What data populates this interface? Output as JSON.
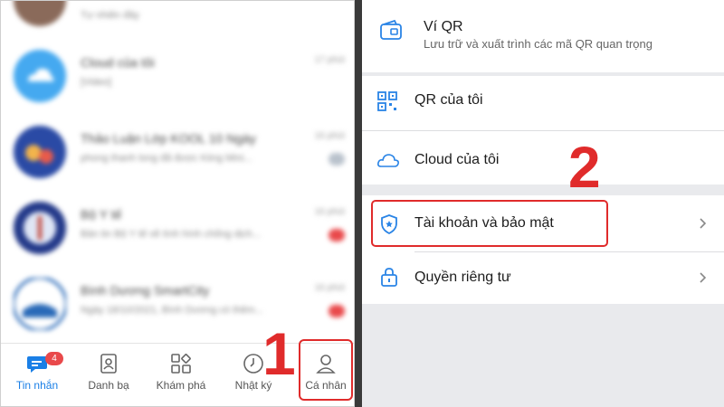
{
  "left_panel": {
    "conversations": [
      {
        "name": "",
        "preview": "Tự nhiên đây",
        "time": ""
      },
      {
        "name": "Cloud của tôi",
        "preview": "[Video]",
        "time": "17 phút"
      },
      {
        "name": "Thảo Luận Lớp KOOL 10 Ngày",
        "preview": "phong thanh long đã được Kiing Mini...",
        "time": "16 phút"
      },
      {
        "name": "Bộ Y tế",
        "preview": "Bản tin Bộ Y tế về tình hình chống dịch...",
        "time": "16 phút"
      },
      {
        "name": "Bình Dương SmartCity",
        "preview": "Ngày 18/10/2021, Bình Dương có thêm...",
        "time": "16 phút"
      }
    ],
    "bottom_nav": {
      "items": [
        {
          "label": "Tin nhắn",
          "icon": "chat-icon",
          "badge": "4",
          "active": true
        },
        {
          "label": "Danh bạ",
          "icon": "contacts-icon"
        },
        {
          "label": "Khám phá",
          "icon": "explore-icon"
        },
        {
          "label": "Nhật ký",
          "icon": "clock-icon"
        },
        {
          "label": "Cá nhân",
          "icon": "person-icon"
        }
      ]
    },
    "step_number": "1"
  },
  "right_panel": {
    "vi_qr": {
      "title": "Ví QR",
      "subtitle": "Lưu trữ và xuất trình các mã QR quan trọng",
      "icon": "wallet-icon"
    },
    "qr_cua_toi": {
      "title": "QR của tôi",
      "icon": "qr-icon"
    },
    "cloud_cua_toi": {
      "title": "Cloud của tôi",
      "icon": "cloud-icon"
    },
    "tai_khoan": {
      "title": "Tài khoản và bảo mật",
      "icon": "shield-icon"
    },
    "quyen_rieng_tu": {
      "title": "Quyền riêng tư",
      "icon": "lock-icon"
    },
    "step_number": "2"
  },
  "colors": {
    "accent": "#1a7fe6",
    "highlight": "#e02b2b",
    "badge": "#e9494b"
  }
}
